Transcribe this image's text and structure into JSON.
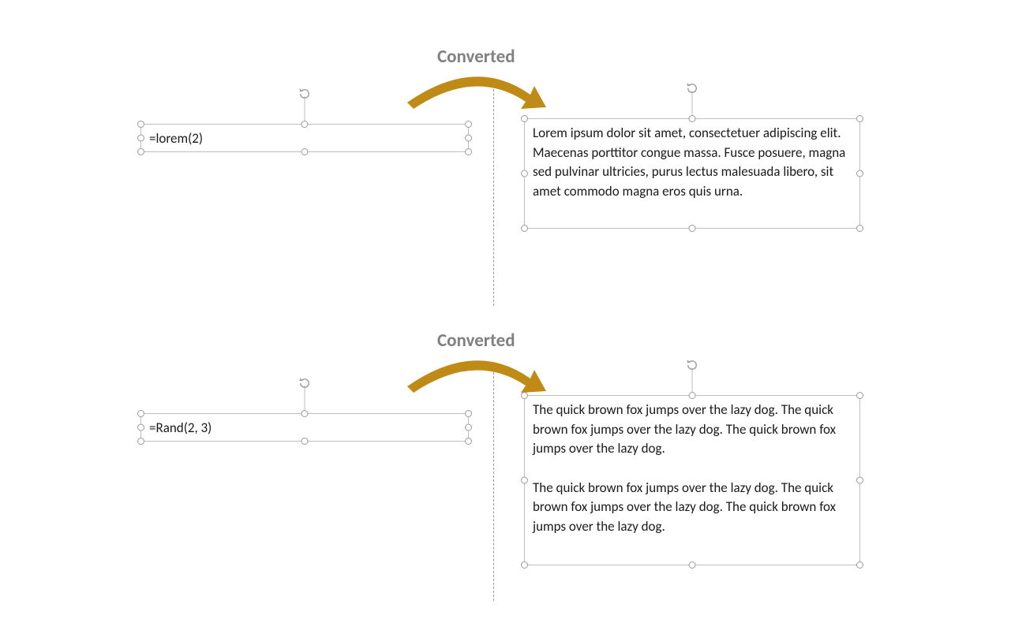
{
  "colors": {
    "arrow": "#c08a16",
    "label": "#808080",
    "handle_border": "#9a9a9a",
    "box_border": "#bfbfbf"
  },
  "labels": {
    "converted": "Converted"
  },
  "examples": [
    {
      "input_text": "=lorem(2)",
      "output_text": "Lorem ipsum dolor sit amet, consectetuer adipiscing elit. Maecenas porttitor congue massa. Fusce posuere, magna sed pulvinar ultricies, purus lectus malesuada libero, sit amet commodo magna eros quis urna."
    },
    {
      "input_text": "=Rand(2, 3)",
      "output_text": "The quick brown fox jumps over the lazy dog. The quick brown fox jumps over the lazy dog. The quick brown fox jumps over the lazy dog.\n\nThe quick brown fox jumps over the lazy dog. The quick brown fox jumps over the lazy dog. The quick brown fox jumps over the lazy dog."
    }
  ]
}
